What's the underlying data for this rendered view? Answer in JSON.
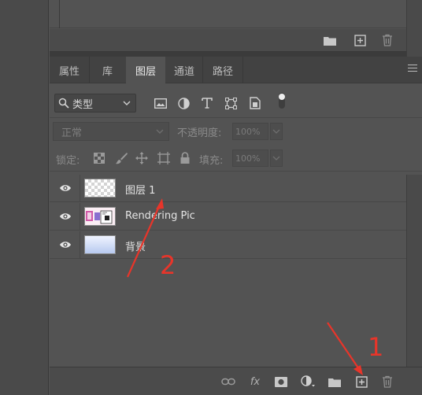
{
  "upper_panel": {
    "footer_icons": [
      "folder-icon",
      "new-layer-icon",
      "trash-icon"
    ]
  },
  "layers_panel": {
    "tabs": [
      {
        "label": "属性",
        "active": false
      },
      {
        "label": "库",
        "active": false
      },
      {
        "label": "图层",
        "active": true
      },
      {
        "label": "通道",
        "active": false
      },
      {
        "label": "路径",
        "active": false
      }
    ],
    "filter": {
      "kind_label": "类型",
      "filter_icons": [
        "image-filter-icon",
        "adjustment-filter-icon",
        "type-filter-icon",
        "shape-filter-icon",
        "smart-object-filter-icon",
        "filter-toggle-icon"
      ]
    },
    "blend": {
      "mode": "正常",
      "opacity_label": "不透明度:",
      "opacity_value": "100%"
    },
    "lock": {
      "label": "锁定:",
      "fill_label": "填充:",
      "fill_value": "100%",
      "lock_icons": [
        "lock-transparent-icon",
        "lock-image-icon",
        "lock-position-icon",
        "lock-artboard-icon",
        "lock-all-icon"
      ]
    },
    "layers": [
      {
        "name": "图层 1",
        "visible": true,
        "thumbnail": "transparent"
      },
      {
        "name": "Rendering Pic",
        "visible": true,
        "thumbnail": "image"
      },
      {
        "name": "背景",
        "visible": true,
        "thumbnail": "gradient"
      }
    ],
    "footer_icons": [
      "link-layers-icon",
      "fx-icon",
      "add-mask-icon",
      "adjustment-layer-icon",
      "group-folder-icon",
      "new-layer-icon",
      "delete-layer-icon"
    ],
    "footer_fx_label": "fx"
  },
  "annotations": {
    "labels": [
      "1",
      "2"
    ],
    "color": "#e8352a"
  },
  "colors": {
    "panel_bg": "#535353",
    "tab_bar_bg": "#424242",
    "accent_red": "#e8352a"
  }
}
